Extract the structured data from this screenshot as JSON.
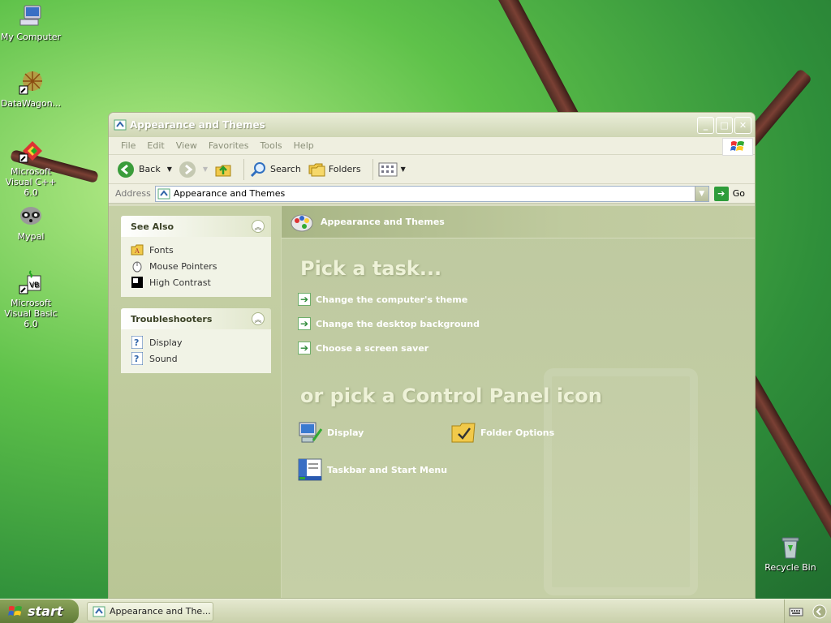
{
  "desktop": {
    "icons": [
      {
        "label": "My Computer"
      },
      {
        "label": "DataWagon..."
      },
      {
        "label": "Microsoft Visual C++ 6.0"
      },
      {
        "label": "Mypal"
      },
      {
        "label": "Microsoft Visual Basic 6.0"
      },
      {
        "label": "Recycle Bin"
      }
    ]
  },
  "window": {
    "title": "Appearance and Themes",
    "menu": [
      "File",
      "Edit",
      "View",
      "Favorites",
      "Tools",
      "Help"
    ],
    "toolbar": {
      "back": "Back",
      "search": "Search",
      "folders": "Folders"
    },
    "address": {
      "label": "Address",
      "value": "Appearance and Themes",
      "go": "Go"
    },
    "see_also": {
      "title": "See Also",
      "items": [
        "Fonts",
        "Mouse Pointers",
        "High Contrast"
      ]
    },
    "troubleshooters": {
      "title": "Troubleshooters",
      "items": [
        "Display",
        "Sound"
      ]
    },
    "main": {
      "header": "Appearance and Themes",
      "pick_task": "Pick a task...",
      "tasks": [
        "Change the computer's theme",
        "Change the desktop background",
        "Choose a screen saver"
      ],
      "pick_icon": "or pick a Control Panel icon",
      "icons": [
        "Display",
        "Folder Options",
        "Taskbar and Start Menu"
      ]
    }
  },
  "taskbar": {
    "start": "start",
    "task": "Appearance and The..."
  },
  "colors": {
    "accent_green": "#2e9c3a",
    "window_frame": "#d8dcc0"
  }
}
